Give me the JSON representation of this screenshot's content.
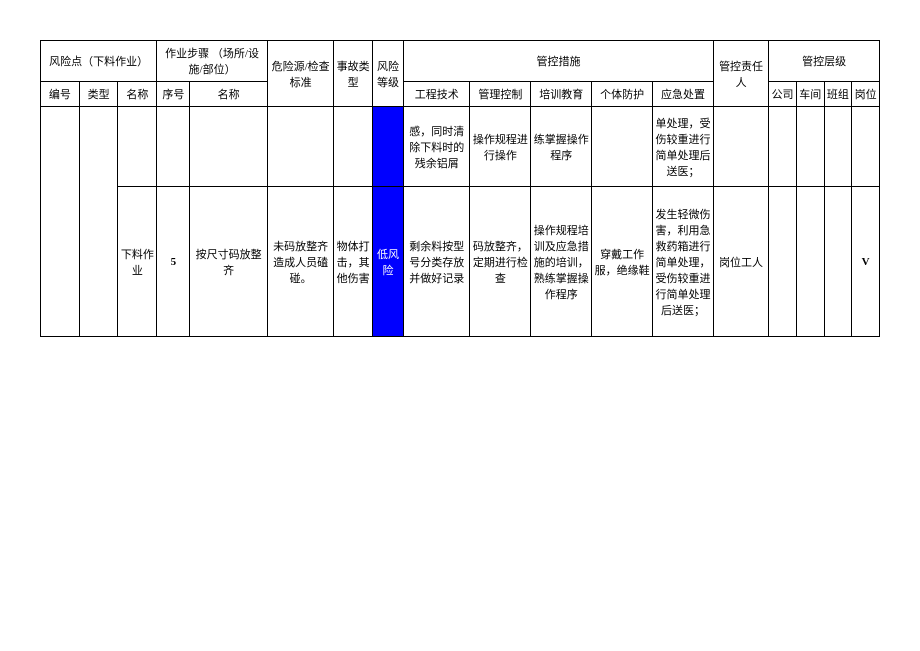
{
  "headers": {
    "risk_point": "风险点（下料作业）",
    "work_step": "作业步骤\n（场所/设施/部位）",
    "hazard_std": "危险源/检查标准",
    "accident_type": "事故类型",
    "risk_level": "风险等级",
    "control_measures": "管控措施",
    "responsible": "管控责任人",
    "control_level": "管控层级",
    "rp_no": "编号",
    "rp_type": "类型",
    "rp_name": "名称",
    "ws_no": "序号",
    "ws_name": "名称",
    "cm_eng": "工程技术",
    "cm_mgmt": "管理控制",
    "cm_train": "培训教育",
    "cm_ppe": "个体防护",
    "cm_emerg": "应急处置",
    "cl_co": "公司",
    "cl_shop": "车间",
    "cl_team": "班组",
    "cl_post": "岗位"
  },
  "rows": [
    {
      "name": "",
      "seq": "",
      "step_name": "",
      "hazard": "",
      "accident": "",
      "risk": "",
      "eng": "感，同时清除下料时的残余铝屑",
      "mgmt": "操作规程进行操作",
      "train": "练掌握操作程序",
      "ppe": "",
      "emerg": "单处理，受伤较重进行简单处理后送医；",
      "resp": "",
      "co": "",
      "shop": "",
      "team": "",
      "post": ""
    },
    {
      "name": "下料作业",
      "seq": "5",
      "step_name": "按尺寸码放整齐",
      "hazard": "未码放整齐造成人员磕碰。",
      "accident": "物体打击，其他伤害",
      "risk": "低风险",
      "eng": "剩余料按型号分类存放并做好记录",
      "mgmt": "码放整齐，定期进行检查",
      "train": "操作规程培训及应急措施的培训，熟练掌握操作程序",
      "ppe": "穿戴工作服，绝缘鞋",
      "emerg": "发生轻微伤害，利用急救药箱进行简单处理，受伤较重进行简单处理后送医；",
      "resp": "岗位工人",
      "co": "",
      "shop": "",
      "team": "",
      "post": "V"
    }
  ]
}
